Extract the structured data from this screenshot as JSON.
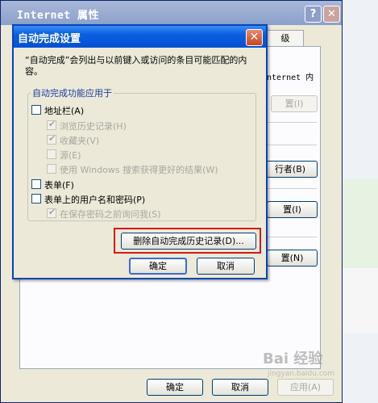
{
  "back_dialog": {
    "title": "Internet 属性",
    "help_glyph": "?",
    "close_glyph": "✕",
    "tab_fragment": "级",
    "ie_text_fragment": "nternet 内",
    "btn_a": "置(I)",
    "btn_b": "行者(B)",
    "btn_c": "置(I)",
    "btn_d": "置(N)",
    "ok": "确定",
    "cancel": "取消",
    "apply": "应用(A)"
  },
  "front_dialog": {
    "title": "自动完成设置",
    "close_glyph": "✕",
    "description": "“自动完成”会列出与以前键入或访问的条目可能匹配的内容。",
    "group_label": "自动完成功能应用于",
    "options": {
      "address_bar": "地址栏(A)",
      "browsing_history": "浏览历史记录(H)",
      "favorites": "收藏夹(V)",
      "feeds": "源(E)",
      "windows_search": "使用 Windows 搜索获得更好的结果(W)",
      "forms": "表单(F)",
      "usernames_passwords": "表单上的用户名和密码(P)",
      "ask_before_save": "在保存密码之前询问我(S)"
    },
    "delete_history_button": "删除自动完成历史记录(D)...",
    "ok": "确定",
    "cancel": "取消"
  },
  "watermark": {
    "text": "Bai 经验",
    "sub": "jingyan.baidu.com"
  },
  "colors": {
    "front_titlebar": "#0a5fe0",
    "highlight_box": "#d11a1a",
    "dialog_face": "#ece9d8"
  }
}
